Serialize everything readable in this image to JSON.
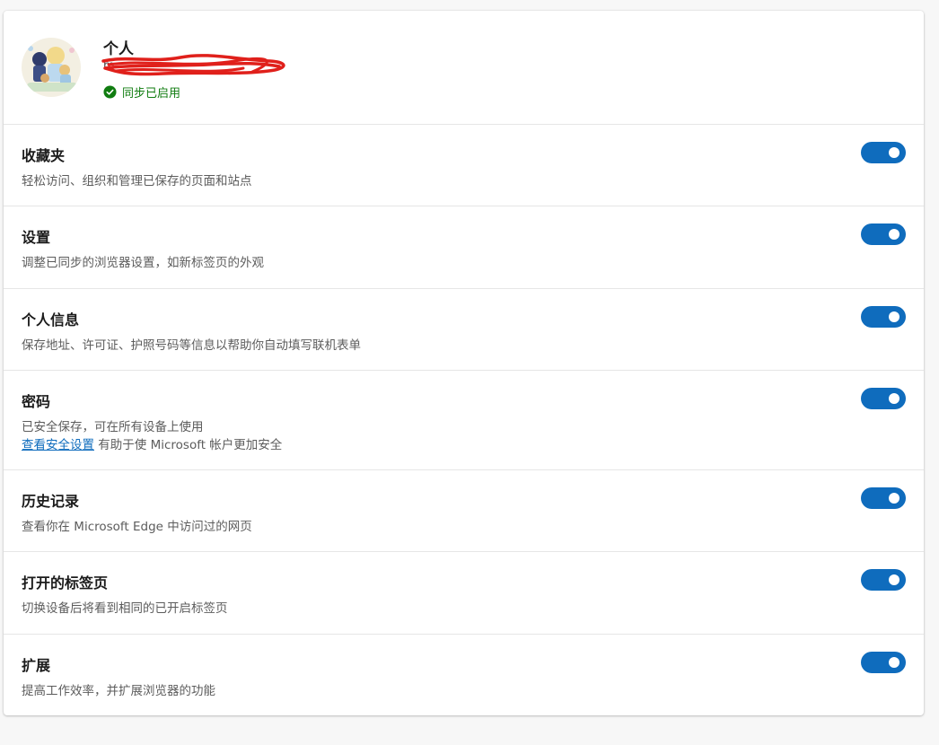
{
  "profile": {
    "name": "个人",
    "email": "m",
    "sync_status": "同步已启用"
  },
  "sync_items": [
    {
      "title": "收藏夹",
      "description": "轻松访问、组织和管理已保存的页面和站点",
      "enabled": true
    },
    {
      "title": "设置",
      "description": "调整已同步的浏览器设置，如新标签页的外观",
      "enabled": true
    },
    {
      "title": "个人信息",
      "description": "保存地址、许可证、护照号码等信息以帮助你自动填写联机表单",
      "enabled": true
    },
    {
      "title": "密码",
      "description": "已安全保存，可在所有设备上使用",
      "link_text": "查看安全设置",
      "link_suffix": " 有助于使 Microsoft 帐户更加安全",
      "enabled": true
    },
    {
      "title": "历史记录",
      "description": "查看你在 Microsoft Edge 中访问过的网页",
      "enabled": true
    },
    {
      "title": "打开的标签页",
      "description": "切换设备后将看到相同的已开启标签页",
      "enabled": true
    },
    {
      "title": "扩展",
      "description": "提高工作效率，并扩展浏览器的功能",
      "enabled": true
    }
  ],
  "colors": {
    "accent": "#0f6cbd",
    "sync_green": "#107c10",
    "redaction": "#e0201b"
  }
}
